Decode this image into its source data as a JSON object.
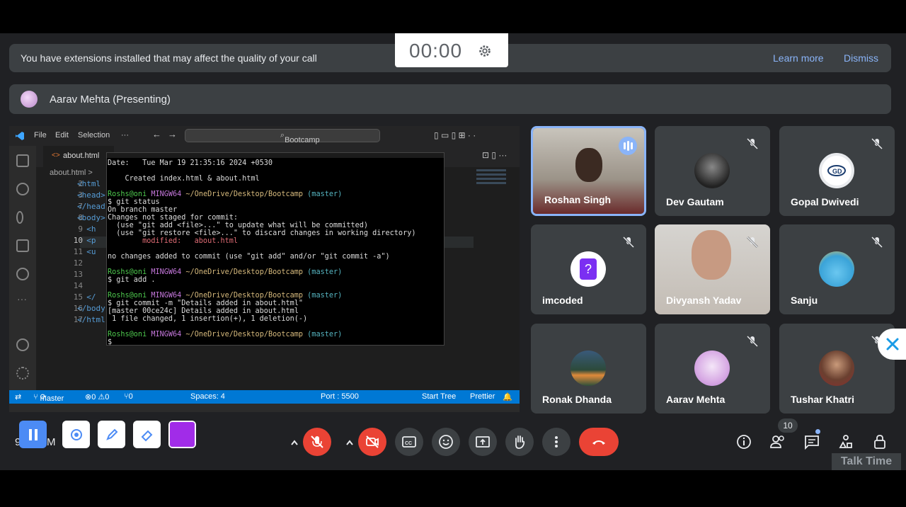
{
  "timer": {
    "value": "00:00"
  },
  "banner": {
    "message": "You have extensions installed that may affect the quality of your call",
    "learn_more": "Learn more",
    "dismiss": "Dismiss"
  },
  "presenter": {
    "label": "Aarav Mehta (Presenting)"
  },
  "vscode": {
    "menu": [
      "File",
      "Edit",
      "Selection",
      "···"
    ],
    "search": "Bootcamp",
    "tab": "about.html",
    "breadcrumb": "about.html >",
    "line_numbers": [
      "2",
      "3",
      "7",
      "8",
      "9",
      "10",
      "11",
      "12",
      "13",
      "14",
      "15",
      "16",
      "17"
    ],
    "code_lines": [
      "<html",
      "<head>",
      "</head",
      "<body>",
      "  <h",
      "  <p",
      "  <u",
      "",
      "",
      "",
      "  </",
      "</body",
      "</html"
    ],
    "status": {
      "branch": "master",
      "problems": "⊗0 ⚠0",
      "ports": "⑂0",
      "spaces": "Spaces: 4",
      "port": "Port : 5500",
      "start_tree": "Start Tree",
      "prettier": "Prettier"
    }
  },
  "terminal": {
    "date_line": "Date:   Tue Mar 19 21:35:16 2024 +0530",
    "commit_msg": "    Created index.html & about.html",
    "prompt_user": "Roshs@oni",
    "prompt_host": "MINGW64",
    "prompt_path": "~/OneDrive/Desktop/Bootcamp",
    "prompt_branch": "(master)",
    "cmd1": "$ git status",
    "out1": "On branch master",
    "out2": "Changes not staged for commit:",
    "out3": "  (use \"git add <file>...\" to update what will be committed)",
    "out4": "  (use \"git restore <file>...\" to discard changes in working directory)",
    "out5": "        modified:   about.html",
    "out6": "no changes added to commit (use \"git add\" and/or \"git commit -a\")",
    "cmd2": "$ git add .",
    "cmd3": "$ git commit -m \"Details added in about.html\"",
    "out7": "[master 00ce24c] Details added in about.html",
    "out8": " 1 file changed, 1 insertion(+), 1 deletion(-)",
    "cmd4": "$"
  },
  "participants": [
    {
      "name": "Roshan Singh",
      "speaking": true
    },
    {
      "name": "Dev Gautam",
      "muted": true
    },
    {
      "name": "Gopal Dwivedi",
      "muted": true
    },
    {
      "name": "imcoded",
      "muted": true
    },
    {
      "name": "Divyansh Yadav",
      "muted": true
    },
    {
      "name": "Sanju",
      "muted": true
    },
    {
      "name": "Ronak Dhanda"
    },
    {
      "name": "Aarav Mehta",
      "muted": true
    },
    {
      "name": "Tushar Khatri",
      "muted": true
    }
  ],
  "controls": {
    "people_count": "10",
    "talk_time": "Talk Time"
  },
  "colors": {
    "accent": "#8ab4f8",
    "danger": "#ea4335",
    "annotate": "#a12ce8",
    "pause": "#4c8bf5"
  }
}
